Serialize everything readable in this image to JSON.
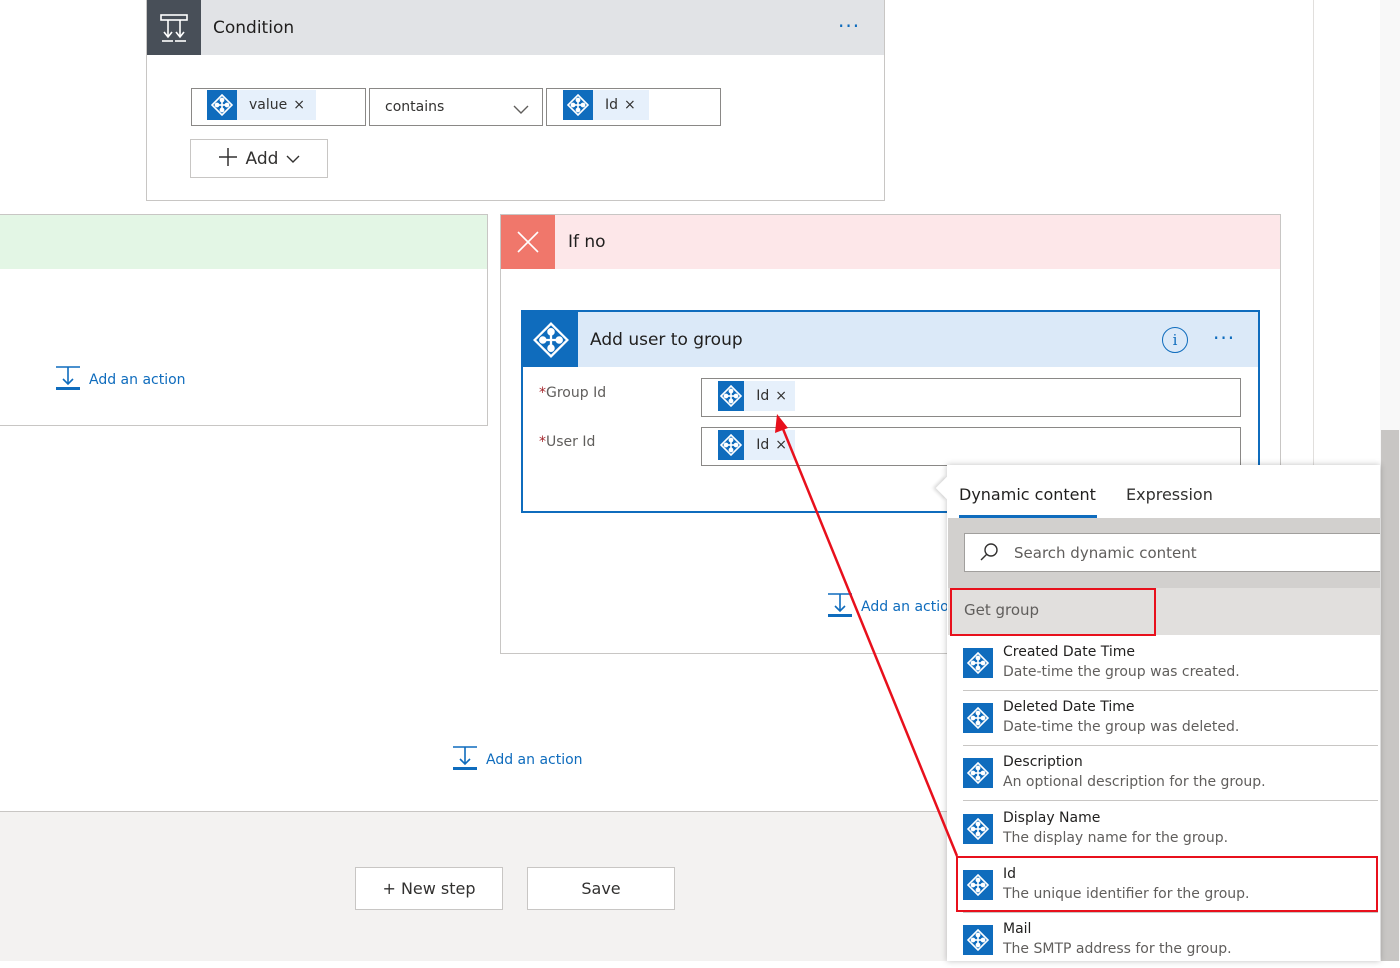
{
  "condition": {
    "title": "Condition",
    "more": "···",
    "left_token": "value",
    "operator": "contains",
    "right_token": "Id",
    "add_label": "Add",
    "token_remove": "×"
  },
  "branch_yes": {
    "add_action": "Add an action"
  },
  "branch_no": {
    "title": "If no",
    "add_action": "Add an action"
  },
  "add_user_card": {
    "title": "Add user to group",
    "info": "i",
    "more": "···",
    "group_label": "Group Id",
    "user_label": "User Id",
    "required_mark": "*",
    "group_token": "Id",
    "user_token": "Id",
    "token_remove": "×"
  },
  "main": {
    "add_action": "Add an action",
    "new_step": "+ New step",
    "save": "Save"
  },
  "dynamic_panel": {
    "tabs": [
      "Dynamic content",
      "Expression"
    ],
    "active_tab": "Dynamic content",
    "search_placeholder": "Search dynamic content",
    "group_header": "Get group",
    "items": [
      {
        "title": "Created Date Time",
        "desc": "Date-time the group was created."
      },
      {
        "title": "Deleted Date Time",
        "desc": "Date-time the group was deleted."
      },
      {
        "title": "Description",
        "desc": "An optional description for the group."
      },
      {
        "title": "Display Name",
        "desc": "The display name for the group."
      },
      {
        "title": "Id",
        "desc": "The unique identifier for the group."
      },
      {
        "title": "Mail",
        "desc": "The SMTP address for the group."
      }
    ]
  },
  "colors": {
    "accent": "#0f6cbd",
    "annotation": "#e8101c",
    "if_no_bg": "#fde7e9",
    "if_no_icon": "#f0776b",
    "if_yes_bg": "#e3f6e5",
    "condition_icon_bg": "#484f58",
    "card_header_bg": "#dbe9f8"
  },
  "icons": {
    "condition": "condition-icon",
    "azure_ad": "azure-ad-icon",
    "close": "close-icon",
    "add_action": "add-action-icon",
    "search": "search-icon",
    "info": "info-icon",
    "chevron": "chevron-down-icon",
    "plus": "plus-icon"
  }
}
